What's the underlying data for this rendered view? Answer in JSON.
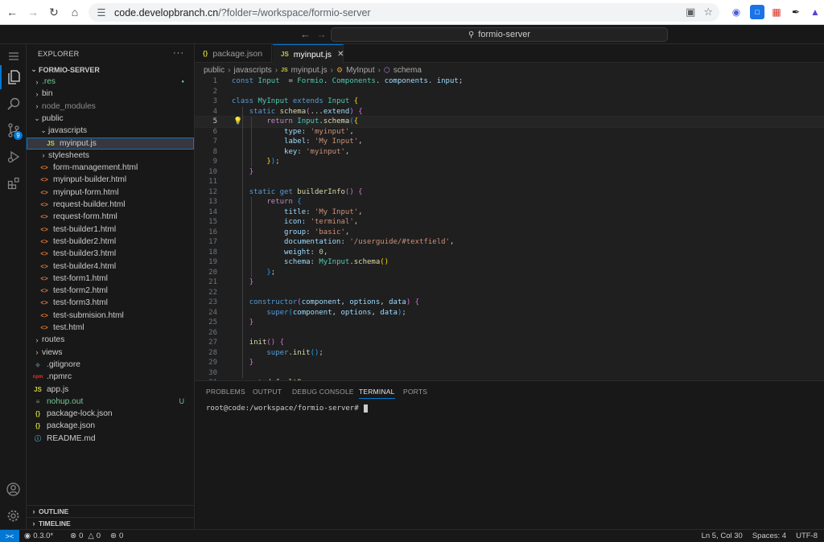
{
  "browser": {
    "url_host": "code.developbranch.cn",
    "url_rest": "/?folder=/workspace/formio-server"
  },
  "titlebar": {
    "command_center": "formio-server"
  },
  "activity": {
    "scm_badge": "9"
  },
  "explorer": {
    "title": "EXPLORER",
    "root": "FORMIO-SERVER",
    "rows": [
      {
        "label": ".res",
        "type": "folder",
        "indent": 1,
        "color": "#73c991",
        "deco": "●",
        "deco_color": "#73c991"
      },
      {
        "label": "bin",
        "type": "folder",
        "indent": 1
      },
      {
        "label": "node_modules",
        "type": "folder",
        "indent": 1,
        "color": "#8c8c8c"
      },
      {
        "label": "public",
        "type": "folder-open",
        "indent": 1
      },
      {
        "label": "javascripts",
        "type": "folder-open",
        "indent": 2
      },
      {
        "label": "myinput.js",
        "type": "js",
        "indent": 3,
        "selected": true
      },
      {
        "label": "stylesheets",
        "type": "folder",
        "indent": 2
      },
      {
        "label": "form-management.html",
        "type": "html",
        "indent": 2
      },
      {
        "label": "myinput-builder.html",
        "type": "html",
        "indent": 2
      },
      {
        "label": "myinput-form.html",
        "type": "html",
        "indent": 2
      },
      {
        "label": "request-builder.html",
        "type": "html",
        "indent": 2
      },
      {
        "label": "request-form.html",
        "type": "html",
        "indent": 2
      },
      {
        "label": "test-builder1.html",
        "type": "html",
        "indent": 2
      },
      {
        "label": "test-builder2.html",
        "type": "html",
        "indent": 2
      },
      {
        "label": "test-builder3.html",
        "type": "html",
        "indent": 2
      },
      {
        "label": "test-builder4.html",
        "type": "html",
        "indent": 2
      },
      {
        "label": "test-form1.html",
        "type": "html",
        "indent": 2
      },
      {
        "label": "test-form2.html",
        "type": "html",
        "indent": 2
      },
      {
        "label": "test-form3.html",
        "type": "html",
        "indent": 2
      },
      {
        "label": "test-submision.html",
        "type": "html",
        "indent": 2
      },
      {
        "label": "test.html",
        "type": "html",
        "indent": 2
      },
      {
        "label": "routes",
        "type": "folder",
        "indent": 1
      },
      {
        "label": "views",
        "type": "folder",
        "indent": 1
      },
      {
        "label": ".gitignore",
        "type": "git",
        "indent": 1
      },
      {
        "label": ".npmrc",
        "type": "npm",
        "indent": 1
      },
      {
        "label": "app.js",
        "type": "js",
        "indent": 1
      },
      {
        "label": "nohup.out",
        "type": "file",
        "indent": 1,
        "color": "#73c991",
        "deco": "U",
        "deco_color": "#73c991"
      },
      {
        "label": "package-lock.json",
        "type": "json",
        "indent": 1
      },
      {
        "label": "package.json",
        "type": "json",
        "indent": 1
      },
      {
        "label": "README.md",
        "type": "info",
        "indent": 1
      }
    ],
    "outline": "OUTLINE",
    "timeline": "TIMELINE"
  },
  "tabs": [
    {
      "label": "package.json",
      "icon": "{}"
    },
    {
      "label": "myinput.js",
      "icon": "JS",
      "active": true
    }
  ],
  "breadcrumb": [
    "public",
    "javascripts",
    "myinput.js",
    "MyInput",
    "schema"
  ],
  "code": {
    "current_line": 5,
    "lines": [
      [
        [
          "kb",
          "const "
        ],
        [
          "cls",
          "Input"
        ],
        [
          "",
          "  = "
        ],
        [
          "cls",
          "Formio"
        ],
        [
          "",
          ". "
        ],
        [
          "cls",
          "Components"
        ],
        [
          "",
          ". "
        ],
        [
          "prop",
          "components"
        ],
        [
          "",
          ". "
        ],
        [
          "prop",
          "input"
        ],
        [
          "",
          ";"
        ]
      ],
      [],
      [
        [
          "kb",
          "class "
        ],
        [
          "cls",
          "MyInput"
        ],
        [
          "",
          " "
        ],
        [
          "kb",
          "extends "
        ],
        [
          "cls",
          "Input"
        ],
        [
          "",
          " "
        ],
        [
          "br1",
          "{"
        ]
      ],
      [
        [
          "",
          "    "
        ],
        [
          "kb",
          "static "
        ],
        [
          "fn",
          "schema"
        ],
        [
          "br2",
          "("
        ],
        [
          "",
          "..."
        ],
        [
          "prop",
          "extend"
        ],
        [
          "br2",
          ")"
        ],
        [
          "",
          " "
        ],
        [
          "br2",
          "{"
        ]
      ],
      [
        [
          "",
          "        "
        ],
        [
          "kw",
          "return "
        ],
        [
          "cls",
          "Input"
        ],
        [
          "",
          "."
        ],
        [
          "fn",
          "schema"
        ],
        [
          "br3",
          "("
        ],
        [
          "br1",
          "{"
        ]
      ],
      [
        [
          "",
          "            "
        ],
        [
          "prop",
          "type"
        ],
        [
          "",
          ": "
        ],
        [
          "str",
          "'myinput'"
        ],
        [
          "",
          ","
        ]
      ],
      [
        [
          "",
          "            "
        ],
        [
          "prop",
          "label"
        ],
        [
          "",
          ": "
        ],
        [
          "str",
          "'My Input'"
        ],
        [
          "",
          ","
        ]
      ],
      [
        [
          "",
          "            "
        ],
        [
          "prop",
          "key"
        ],
        [
          "",
          ": "
        ],
        [
          "str",
          "'myinput'"
        ],
        [
          "",
          ","
        ]
      ],
      [
        [
          "",
          "        "
        ],
        [
          "br1",
          "}"
        ],
        [
          "br3",
          ")"
        ],
        [
          "",
          ";"
        ]
      ],
      [
        [
          "",
          "    "
        ],
        [
          "br2",
          "}"
        ]
      ],
      [],
      [
        [
          "",
          "    "
        ],
        [
          "kb",
          "static get "
        ],
        [
          "fn",
          "builderInfo"
        ],
        [
          "br2",
          "()"
        ],
        [
          "",
          " "
        ],
        [
          "br2",
          "{"
        ]
      ],
      [
        [
          "",
          "        "
        ],
        [
          "kw",
          "return "
        ],
        [
          "br3",
          "{"
        ]
      ],
      [
        [
          "",
          "            "
        ],
        [
          "prop",
          "title"
        ],
        [
          "",
          ": "
        ],
        [
          "str",
          "'My Input'"
        ],
        [
          "",
          ","
        ]
      ],
      [
        [
          "",
          "            "
        ],
        [
          "prop",
          "icon"
        ],
        [
          "",
          ": "
        ],
        [
          "str",
          "'terminal'"
        ],
        [
          "",
          ","
        ]
      ],
      [
        [
          "",
          "            "
        ],
        [
          "prop",
          "group"
        ],
        [
          "",
          ": "
        ],
        [
          "str",
          "'basic'"
        ],
        [
          "",
          ","
        ]
      ],
      [
        [
          "",
          "            "
        ],
        [
          "prop",
          "documentation"
        ],
        [
          "",
          ": "
        ],
        [
          "str",
          "'/userguide/#textfield'"
        ],
        [
          "",
          ","
        ]
      ],
      [
        [
          "",
          "            "
        ],
        [
          "prop",
          "weight"
        ],
        [
          "",
          ": "
        ],
        [
          "num",
          "0"
        ],
        [
          "",
          ","
        ]
      ],
      [
        [
          "",
          "            "
        ],
        [
          "prop",
          "schema"
        ],
        [
          "",
          ": "
        ],
        [
          "cls",
          "MyInput"
        ],
        [
          "",
          "."
        ],
        [
          "fn",
          "schema"
        ],
        [
          "br1",
          "()"
        ]
      ],
      [
        [
          "",
          "        "
        ],
        [
          "br3",
          "}"
        ],
        [
          "",
          ";"
        ]
      ],
      [
        [
          "",
          "    "
        ],
        [
          "br2",
          "}"
        ]
      ],
      [],
      [
        [
          "",
          "    "
        ],
        [
          "kb",
          "constructor"
        ],
        [
          "br2",
          "("
        ],
        [
          "prop",
          "component"
        ],
        [
          "",
          ", "
        ],
        [
          "prop",
          "options"
        ],
        [
          "",
          ", "
        ],
        [
          "prop",
          "data"
        ],
        [
          "br2",
          ")"
        ],
        [
          "",
          " "
        ],
        [
          "br2",
          "{"
        ]
      ],
      [
        [
          "",
          "        "
        ],
        [
          "kb",
          "super"
        ],
        [
          "br3",
          "("
        ],
        [
          "prop",
          "component"
        ],
        [
          "",
          ", "
        ],
        [
          "prop",
          "options"
        ],
        [
          "",
          ", "
        ],
        [
          "prop",
          "data"
        ],
        [
          "br3",
          ")"
        ],
        [
          "",
          ";"
        ]
      ],
      [
        [
          "",
          "    "
        ],
        [
          "br2",
          "}"
        ]
      ],
      [],
      [
        [
          "",
          "    "
        ],
        [
          "fn",
          "init"
        ],
        [
          "br2",
          "()"
        ],
        [
          "",
          " "
        ],
        [
          "br2",
          "{"
        ]
      ],
      [
        [
          "",
          "        "
        ],
        [
          "kb",
          "super"
        ],
        [
          "",
          "."
        ],
        [
          "fn",
          "init"
        ],
        [
          "br3",
          "()"
        ],
        [
          "",
          ";"
        ]
      ],
      [
        [
          "",
          "    "
        ],
        [
          "br2",
          "}"
        ]
      ],
      [],
      [
        [
          "",
          "    "
        ],
        [
          "kb",
          "get "
        ],
        [
          "fn",
          "defaultS"
        ]
      ]
    ]
  },
  "panel": {
    "tabs": [
      "PROBLEMS",
      "OUTPUT",
      "DEBUG CONSOLE",
      "TERMINAL",
      "PORTS"
    ],
    "active": "TERMINAL",
    "prompt": "root@code:/workspace/formio-server#"
  },
  "status": {
    "remote_icon": "><",
    "version": "0.3.0*",
    "errors": "0",
    "warnings": "0",
    "ports": "0",
    "position": "Ln 5, Col 30",
    "spaces": "Spaces: 4",
    "encoding": "UTF-8"
  }
}
